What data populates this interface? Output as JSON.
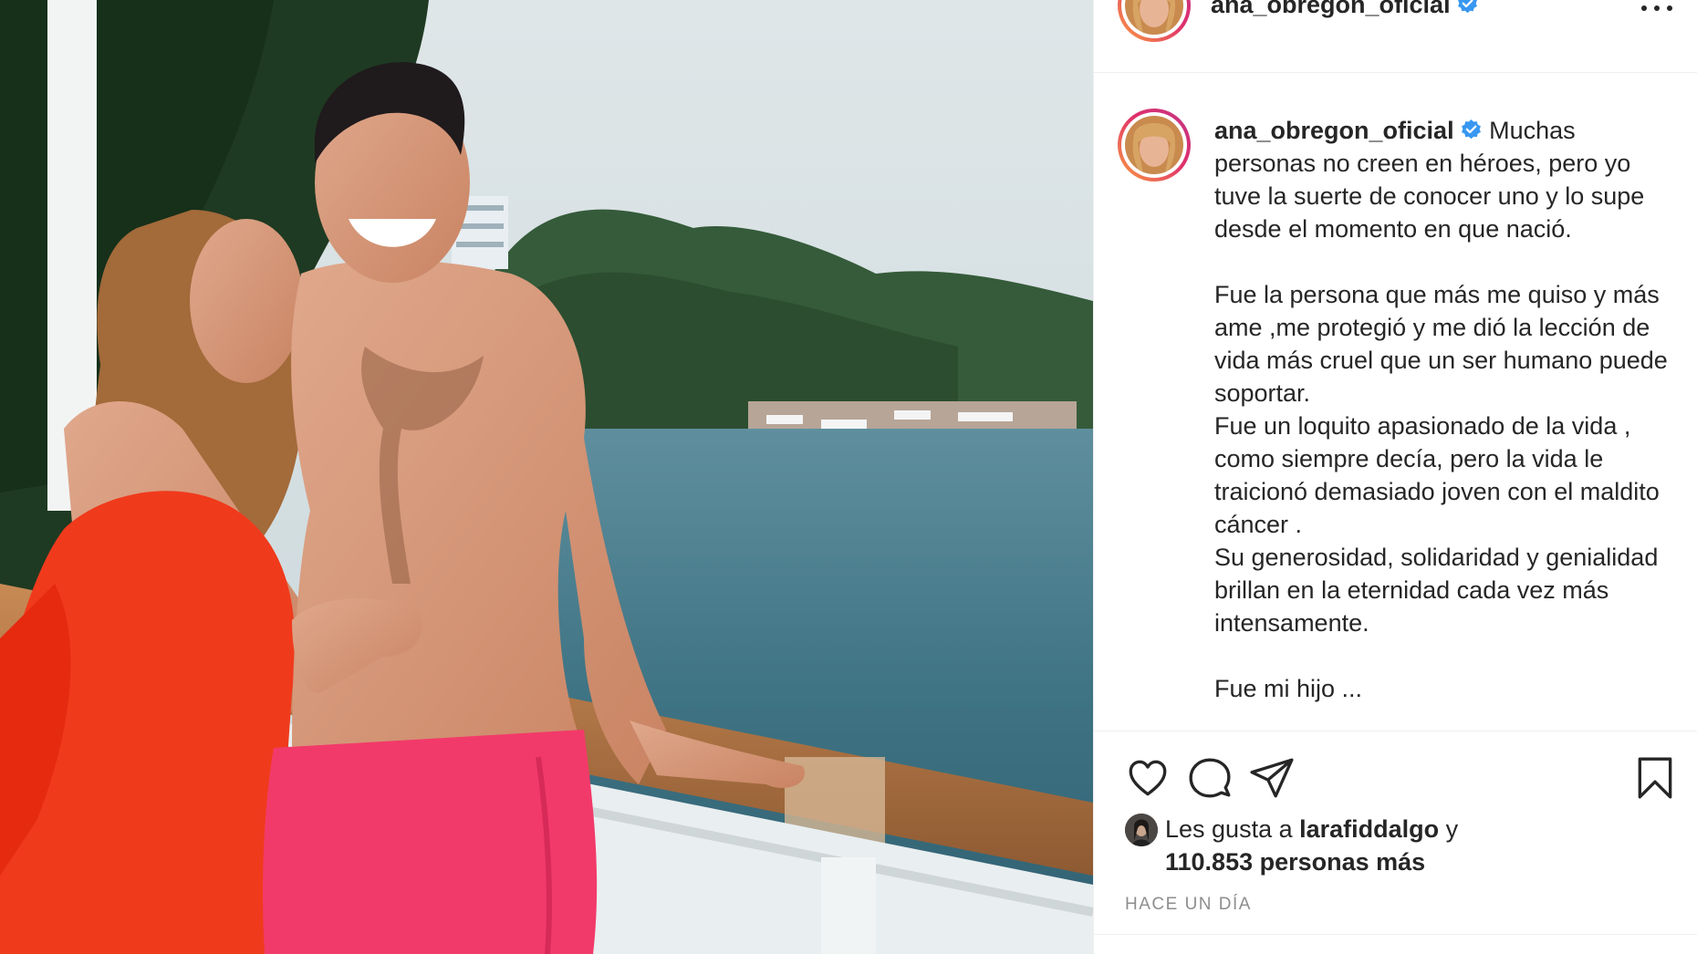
{
  "post": {
    "username": "ana_obregon_oficial",
    "verified_icon": "verified-badge-icon",
    "more_icon": "more-options-icon"
  },
  "caption": {
    "username": "ana_obregon_oficial",
    "text": "Muchas personas no creen en héroes, pero yo tuve la suerte de conocer uno y lo supe desde el momento en que nació.\n\nFue la persona que más me quiso y más ame ,me protegió y me dió la lección de vida más cruel que un ser humano puede soportar.\nFue un loquito apasionado de la vida , como siempre decía, pero la vida le traicionó demasiado joven con el maldito cáncer .\nSu generosidad, solidaridad y genialidad brillan en la eternidad cada vez más intensamente.\n\nFue mi hijo ..."
  },
  "actions": {
    "like_icon": "heart-icon",
    "comment_icon": "comment-icon",
    "share_icon": "share-icon",
    "save_icon": "bookmark-icon"
  },
  "likes": {
    "prefix": "Les gusta a",
    "liker": "larafiddalgo",
    "conjunction": "y",
    "count_text": "110.853 personas más"
  },
  "timestamp": "HACE UN DÍA",
  "colors": {
    "text": "#262626",
    "muted": "#8e8e8e",
    "verified": "#3897f0",
    "ring_start": "#f9a03f",
    "ring_end": "#c13584",
    "divider": "#efefef"
  }
}
